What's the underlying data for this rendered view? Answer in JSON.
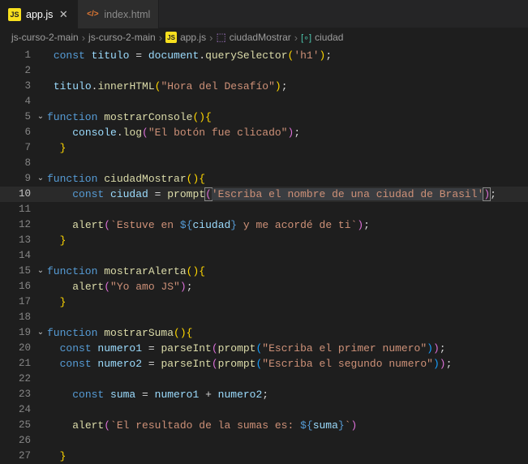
{
  "tabs": {
    "active": {
      "icon_label": "JS",
      "label": "app.js"
    },
    "inactive": {
      "icon_glyph": "</>",
      "label": "index.html"
    }
  },
  "breadcrumbs": {
    "seg1": "js-curso-2-main",
    "seg2": "js-curso-2-main",
    "seg3_icon": "JS",
    "seg3": "app.js",
    "seg4": "ciudadMostrar",
    "seg5_icon": "[∘]",
    "seg5": "ciudad"
  },
  "code": {
    "l1": {
      "n": "1",
      "a": "const ",
      "b": "titulo",
      "c": " = ",
      "d": "document",
      "e": ".",
      "f": "querySelector",
      "g": "'h1'",
      "h": ";"
    },
    "l2": {
      "n": "2"
    },
    "l3": {
      "n": "3",
      "a": "titulo",
      "b": ".",
      "c": "innerHTML",
      "d": "(",
      "e": "\"Hora del Desafío\"",
      "f": ")",
      "g": ";"
    },
    "l4": {
      "n": "4"
    },
    "l5": {
      "n": "5",
      "a": "function ",
      "b": "mostrarConsole",
      "c": "()",
      "d": "{"
    },
    "l6": {
      "n": "6",
      "a": "console",
      "b": ".",
      "c": "log",
      "d": "(",
      "e": "\"El botón fue clicado\"",
      "f": ")",
      "g": ";"
    },
    "l7": {
      "n": "7",
      "a": "}"
    },
    "l8": {
      "n": "8"
    },
    "l9": {
      "n": "9",
      "a": "function ",
      "b": "ciudadMostrar",
      "c": "()",
      "d": "{"
    },
    "l10": {
      "n": "10",
      "a": "const ",
      "b": "ciudad",
      "c": " = ",
      "d": "prompt",
      "e": "(",
      "f": "'Escriba el nombre de una ciudad de Brasil'",
      "g": ")",
      "h": ";"
    },
    "l11": {
      "n": "11"
    },
    "l12": {
      "n": "12",
      "a": "alert",
      "b": "(",
      "c": "`Estuve en ",
      "d": "${",
      "e": "ciudad",
      "f": "}",
      "g": " y me acordé de ti`",
      "h": ")",
      "i": ";"
    },
    "l13": {
      "n": "13",
      "a": "}"
    },
    "l14": {
      "n": "14"
    },
    "l15": {
      "n": "15",
      "a": "function ",
      "b": "mostrarAlerta",
      "c": "()",
      "d": "{"
    },
    "l16": {
      "n": "16",
      "a": "alert",
      "b": "(",
      "c": "\"Yo amo JS\"",
      "d": ")",
      "e": ";"
    },
    "l17": {
      "n": "17",
      "a": "}"
    },
    "l18": {
      "n": "18"
    },
    "l19": {
      "n": "19",
      "a": "function ",
      "b": "mostrarSuma",
      "c": "()",
      "d": "{"
    },
    "l20": {
      "n": "20",
      "a": "const ",
      "b": "numero1",
      "c": " = ",
      "d": "parseInt",
      "e": "(",
      "f": "prompt",
      "g": "(",
      "h": "\"Escriba el primer numero\"",
      "i": ")",
      "j": ")",
      "k": ";"
    },
    "l21": {
      "n": "21",
      "a": "const ",
      "b": "numero2",
      "c": " = ",
      "d": "parseInt",
      "e": "(",
      "f": "prompt",
      "g": "(",
      "h": "\"Escriba el segundo numero\"",
      "i": ")",
      "j": ")",
      "k": ";"
    },
    "l22": {
      "n": "22"
    },
    "l23": {
      "n": "23",
      "a": "const ",
      "b": "suma",
      "c": " = ",
      "d": "numero1",
      "e": " + ",
      "f": "numero2",
      "g": ";"
    },
    "l24": {
      "n": "24"
    },
    "l25": {
      "n": "25",
      "a": "alert",
      "b": "(",
      "c": "`El resultado de la sumas es: ",
      "d": "${",
      "e": "suma",
      "f": "}",
      "g": "`",
      "h": ")"
    },
    "l26": {
      "n": "26"
    },
    "l27": {
      "n": "27",
      "a": "}"
    }
  }
}
